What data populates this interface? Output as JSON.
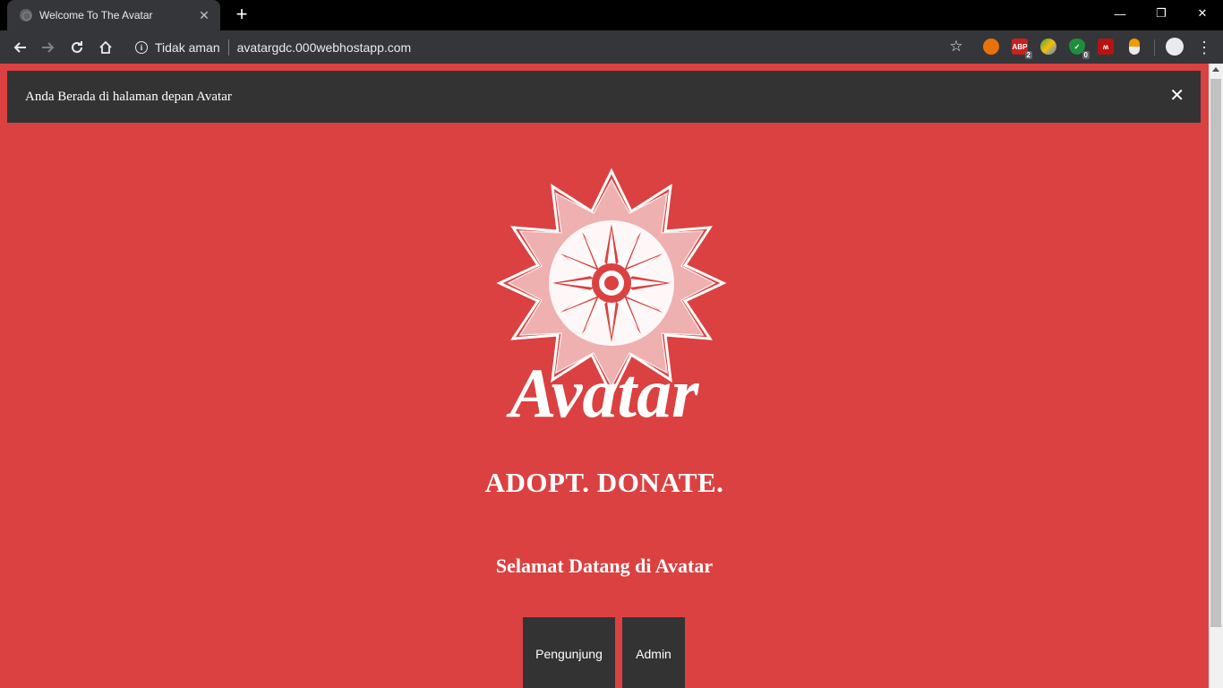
{
  "browser": {
    "tab_title": "Welcome To The Avatar",
    "tab_close": "✕",
    "new_tab": "+",
    "window_controls": {
      "minimize": "—",
      "restore": "❐",
      "close": "✕"
    },
    "security_label": "Tidak aman",
    "url": "avatargdc.000webhostapp.com",
    "extensions": [
      {
        "name": "fire-extension-icon",
        "color": "#e8730c",
        "badge": ""
      },
      {
        "name": "adblock-extension-icon",
        "color": "#c5221f",
        "label": "ABP",
        "badge": "2"
      },
      {
        "name": "colorful-extension-icon",
        "color": "#34a853",
        "badge": ""
      },
      {
        "name": "shield-extension-icon",
        "color": "#1e8e3e",
        "label": "✓",
        "badge": "0"
      },
      {
        "name": "mega-extension-icon",
        "color": "#d93025",
        "label": "ʍ",
        "badge": ""
      },
      {
        "name": "capsule-extension-icon",
        "color": "#f29900",
        "badge": ""
      }
    ]
  },
  "notice": {
    "message": "Anda Berada di halaman depan Avatar",
    "close": "✕"
  },
  "hero": {
    "logo_text": "Avatar",
    "tagline": "ADOPT. DONATE.",
    "welcome": "Selamat Datang di Avatar"
  },
  "buttons": {
    "visitor": "Pengunjung",
    "admin": "Admin"
  },
  "colors": {
    "page_bg": "#db4141",
    "dark_panel": "#333333"
  }
}
